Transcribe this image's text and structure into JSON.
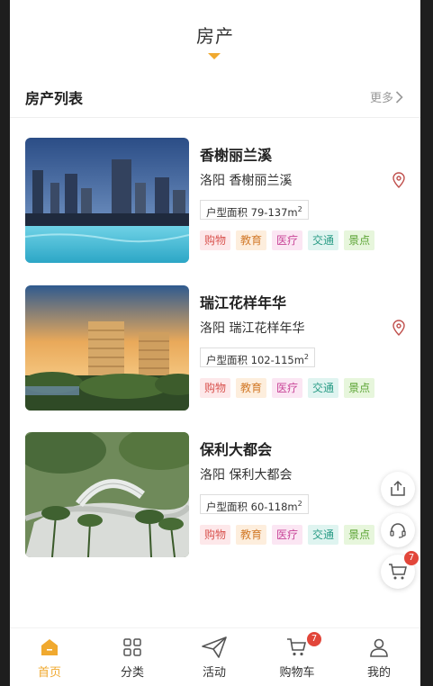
{
  "header": {
    "title": "房产"
  },
  "section": {
    "title": "房产列表",
    "more_label": "更多"
  },
  "properties": [
    {
      "title": "香榭丽兰溪",
      "address": "洛阳 香榭丽兰溪",
      "area_label": "户型面积",
      "area_range": "79-137m",
      "area_unit_sup": "2",
      "tags": [
        "购物",
        "教育",
        "医疗",
        "交通",
        "景点"
      ]
    },
    {
      "title": "瑞江花样年华",
      "address": "洛阳 瑞江花样年华",
      "area_label": "户型面积",
      "area_range": "102-115m",
      "area_unit_sup": "2",
      "tags": [
        "购物",
        "教育",
        "医疗",
        "交通",
        "景点"
      ]
    },
    {
      "title": "保利大都会",
      "address": "洛阳 保利大都会",
      "area_label": "户型面积",
      "area_range": "60-118m",
      "area_unit_sup": "2",
      "tags": [
        "购物",
        "教育",
        "医疗",
        "交通",
        "景点"
      ]
    }
  ],
  "tag_colors": {
    "购物": {
      "bg": "#fde8ea",
      "fg": "#d9534f"
    },
    "教育": {
      "bg": "#fdeedd",
      "fg": "#d27a2a"
    },
    "医疗": {
      "bg": "#fbe6f3",
      "fg": "#c94598"
    },
    "交通": {
      "bg": "#dff4f0",
      "fg": "#2a9c86"
    },
    "景点": {
      "bg": "#e7f6dc",
      "fg": "#5aa332"
    }
  },
  "floating_buttons": {
    "share_icon": "share-icon",
    "service_icon": "headset-icon",
    "cart_icon": "cart-icon",
    "cart_badge": "7"
  },
  "tabbar": {
    "items": [
      {
        "label": "首页",
        "icon": "home-icon",
        "active": true
      },
      {
        "label": "分类",
        "icon": "grid-icon",
        "active": false
      },
      {
        "label": "活动",
        "icon": "paper-plane-icon",
        "active": false
      },
      {
        "label": "购物车",
        "icon": "cart-icon",
        "active": false,
        "badge": "7"
      },
      {
        "label": "我的",
        "icon": "user-icon",
        "active": false
      }
    ]
  },
  "accent_color": "#f0a92f"
}
